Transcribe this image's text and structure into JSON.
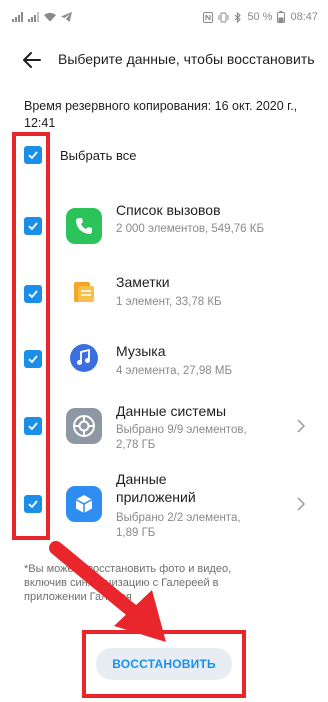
{
  "status_bar": {
    "battery_percent": "50 %",
    "time": "08:47"
  },
  "header": {
    "title": "Выберите данные, чтобы восстановить"
  },
  "backup_time": "Время резервного копирования: 16 окт. 2020 г., 12:41",
  "select_all": {
    "label": "Выбрать все",
    "checked": true
  },
  "items": [
    {
      "title": "Список вызовов",
      "subtitle": "2 000 элементов, 549,76 КБ",
      "icon": "phone-icon",
      "color": "#2bc45a",
      "checked": true,
      "has_chevron": false
    },
    {
      "title": "Заметки",
      "subtitle": "1 элемент, 33,78 КБ",
      "icon": "notes-icon",
      "color": "#f6a623",
      "checked": true,
      "has_chevron": false
    },
    {
      "title": "Музыка",
      "subtitle": "4 элемента, 27,98 МБ",
      "icon": "music-icon",
      "color": "#3b6fe0",
      "checked": true,
      "has_chevron": false
    },
    {
      "title": "Данные системы",
      "subtitle": "Выбрано 9/9 элементов, 2,78 ГБ",
      "icon": "settings-icon",
      "color": "#8e98a4",
      "checked": true,
      "has_chevron": true
    },
    {
      "title": "Данные приложений",
      "subtitle": "Выбрано 2/2 элемента, 1,89 ГБ",
      "icon": "apps-icon",
      "color": "#2e8df0",
      "checked": true,
      "has_chevron": true
    }
  ],
  "footnote": "*Вы можете восстановить фото и видео, включив синхронизацию с Галереей в приложении Галерея",
  "restore_button": "ВОССТАНОВИТЬ",
  "colors": {
    "accent": "#1a8fe8",
    "highlight": "#e8262c"
  }
}
